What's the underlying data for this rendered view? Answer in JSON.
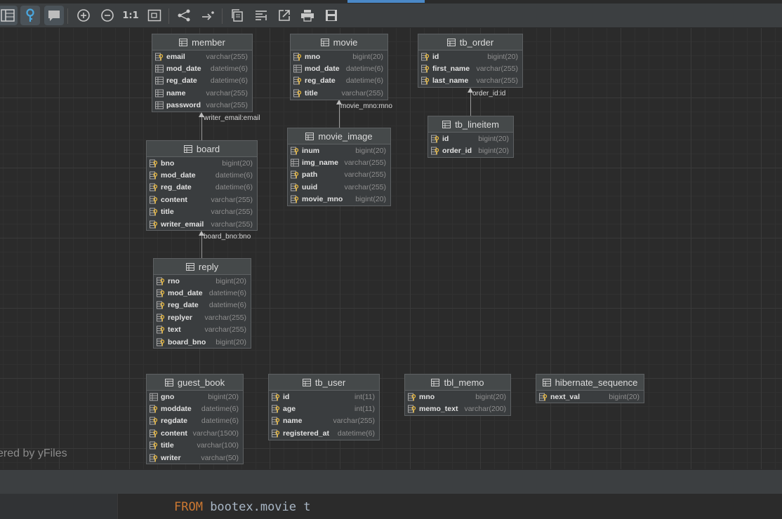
{
  "toolbar": {
    "buttons": [
      {
        "name": "layout-panel",
        "icon": "table-grid-icon",
        "active": true
      },
      {
        "name": "key-toggle",
        "icon": "key-icon",
        "active": true
      },
      {
        "name": "comment-toggle",
        "icon": "comment-icon",
        "active": true
      },
      {
        "name": "zoom-in",
        "icon": "zoom-in-icon"
      },
      {
        "name": "zoom-out",
        "icon": "zoom-out-icon"
      },
      {
        "name": "actual-size",
        "label": "1:1"
      },
      {
        "name": "fit-content",
        "icon": "fit-icon"
      },
      {
        "name": "layout",
        "icon": "share-layout-icon"
      },
      {
        "name": "route-edges",
        "icon": "route-icon"
      },
      {
        "name": "copy",
        "icon": "copy-icon"
      },
      {
        "name": "align",
        "icon": "align-icon"
      },
      {
        "name": "export",
        "icon": "export-icon"
      },
      {
        "name": "print",
        "icon": "print-icon"
      },
      {
        "name": "save",
        "icon": "save-icon"
      }
    ]
  },
  "colors": {
    "accent": "#4a88c7",
    "key_icon": "#e8b73b",
    "keyword": "#cc7832"
  },
  "tables": {
    "member": {
      "name": "member",
      "columns": [
        {
          "name": "email",
          "type": "varchar(255)",
          "icon": "key"
        },
        {
          "name": "mod_date",
          "type": "datetime(6)",
          "icon": "column"
        },
        {
          "name": "reg_date",
          "type": "datetime(6)",
          "icon": "column"
        },
        {
          "name": "name",
          "type": "varchar(255)",
          "icon": "column"
        },
        {
          "name": "password",
          "type": "varchar(255)",
          "icon": "column"
        }
      ]
    },
    "movie": {
      "name": "movie",
      "columns": [
        {
          "name": "mno",
          "type": "bigint(20)",
          "icon": "key"
        },
        {
          "name": "mod_date",
          "type": "datetime(6)",
          "icon": "column"
        },
        {
          "name": "reg_date",
          "type": "datetime(6)",
          "icon": "key"
        },
        {
          "name": "title",
          "type": "varchar(255)",
          "icon": "key"
        }
      ]
    },
    "tb_order": {
      "name": "tb_order",
      "columns": [
        {
          "name": "id",
          "type": "bigint(20)",
          "icon": "key"
        },
        {
          "name": "first_name",
          "type": "varchar(255)",
          "icon": "key"
        },
        {
          "name": "last_name",
          "type": "varchar(255)",
          "icon": "key"
        }
      ]
    },
    "movie_image": {
      "name": "movie_image",
      "columns": [
        {
          "name": "inum",
          "type": "bigint(20)",
          "icon": "key"
        },
        {
          "name": "img_name",
          "type": "varchar(255)",
          "icon": "column"
        },
        {
          "name": "path",
          "type": "varchar(255)",
          "icon": "key"
        },
        {
          "name": "uuid",
          "type": "varchar(255)",
          "icon": "key"
        },
        {
          "name": "movie_mno",
          "type": "bigint(20)",
          "icon": "key"
        }
      ]
    },
    "tb_lineitem": {
      "name": "tb_lineitem",
      "columns": [
        {
          "name": "id",
          "type": "bigint(20)",
          "icon": "key"
        },
        {
          "name": "order_id",
          "type": "bigint(20)",
          "icon": "key"
        }
      ]
    },
    "board": {
      "name": "board",
      "columns": [
        {
          "name": "bno",
          "type": "bigint(20)",
          "icon": "key"
        },
        {
          "name": "mod_date",
          "type": "datetime(6)",
          "icon": "key"
        },
        {
          "name": "reg_date",
          "type": "datetime(6)",
          "icon": "key"
        },
        {
          "name": "content",
          "type": "varchar(255)",
          "icon": "key"
        },
        {
          "name": "title",
          "type": "varchar(255)",
          "icon": "key"
        },
        {
          "name": "writer_email",
          "type": "varchar(255)",
          "icon": "key"
        }
      ]
    },
    "reply": {
      "name": "reply",
      "columns": [
        {
          "name": "rno",
          "type": "bigint(20)",
          "icon": "key"
        },
        {
          "name": "mod_date",
          "type": "datetime(6)",
          "icon": "key"
        },
        {
          "name": "reg_date",
          "type": "datetime(6)",
          "icon": "key"
        },
        {
          "name": "replyer",
          "type": "varchar(255)",
          "icon": "key"
        },
        {
          "name": "text",
          "type": "varchar(255)",
          "icon": "key"
        },
        {
          "name": "board_bno",
          "type": "bigint(20)",
          "icon": "key"
        }
      ]
    },
    "guest_book": {
      "name": "guest_book",
      "columns": [
        {
          "name": "gno",
          "type": "bigint(20)",
          "icon": "column"
        },
        {
          "name": "moddate",
          "type": "datetime(6)",
          "icon": "key"
        },
        {
          "name": "regdate",
          "type": "datetime(6)",
          "icon": "key"
        },
        {
          "name": "content",
          "type": "varchar(1500)",
          "icon": "key"
        },
        {
          "name": "title",
          "type": "varchar(100)",
          "icon": "key"
        },
        {
          "name": "writer",
          "type": "varchar(50)",
          "icon": "key"
        }
      ]
    },
    "tb_user": {
      "name": "tb_user",
      "columns": [
        {
          "name": "id",
          "type": "int(11)",
          "icon": "key"
        },
        {
          "name": "age",
          "type": "int(11)",
          "icon": "key"
        },
        {
          "name": "name",
          "type": "varchar(255)",
          "icon": "key"
        },
        {
          "name": "registered_at",
          "type": "datetime(6)",
          "icon": "key"
        }
      ]
    },
    "tbl_memo": {
      "name": "tbl_memo",
      "columns": [
        {
          "name": "mno",
          "type": "bigint(20)",
          "icon": "key"
        },
        {
          "name": "memo_text",
          "type": "varchar(200)",
          "icon": "key"
        }
      ]
    },
    "hibernate_sequence": {
      "name": "hibernate_sequence",
      "columns": [
        {
          "name": "next_val",
          "type": "bigint(20)",
          "icon": "key"
        }
      ]
    }
  },
  "relations": {
    "board_member": "writer_email:email",
    "movie_image_movie": "movie_mno:mno",
    "lineitem_order": "order_id:id",
    "reply_board": "board_bno:bno"
  },
  "watermark": "ered by yFiles",
  "editor": {
    "keyword": "FROM",
    "rest": " bootex.movie t"
  }
}
